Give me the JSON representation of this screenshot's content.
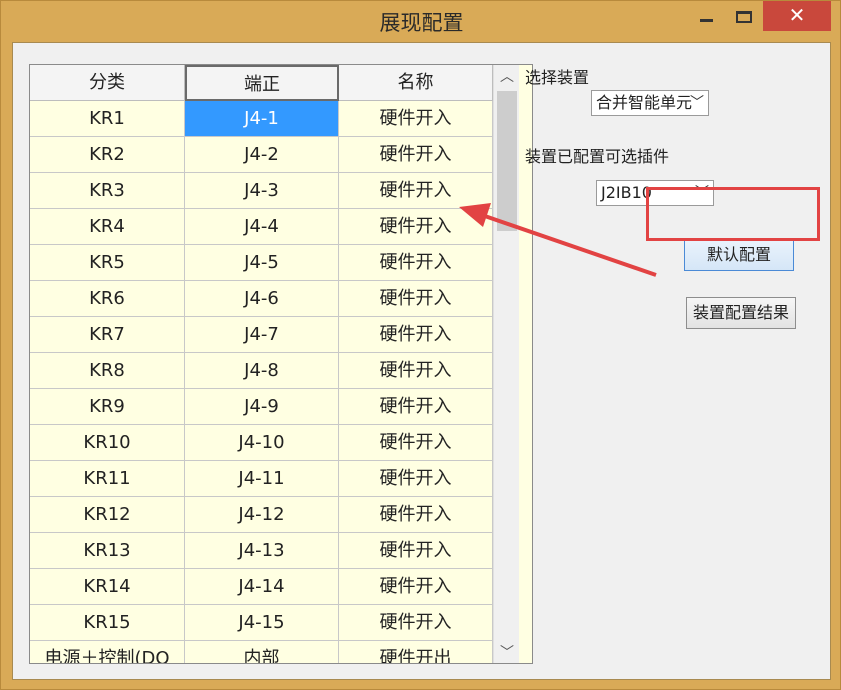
{
  "window": {
    "title": "展现配置",
    "close_glyph": "✕"
  },
  "grid": {
    "headers": [
      "分类",
      "端正",
      "名称"
    ],
    "rows": [
      [
        "KR1",
        "J4-1",
        "硬件开入"
      ],
      [
        "KR2",
        "J4-2",
        "硬件开入"
      ],
      [
        "KR3",
        "J4-3",
        "硬件开入"
      ],
      [
        "KR4",
        "J4-4",
        "硬件开入"
      ],
      [
        "KR5",
        "J4-5",
        "硬件开入"
      ],
      [
        "KR6",
        "J4-6",
        "硬件开入"
      ],
      [
        "KR7",
        "J4-7",
        "硬件开入"
      ],
      [
        "KR8",
        "J4-8",
        "硬件开入"
      ],
      [
        "KR9",
        "J4-9",
        "硬件开入"
      ],
      [
        "KR10",
        "J4-10",
        "硬件开入"
      ],
      [
        "KR11",
        "J4-11",
        "硬件开入"
      ],
      [
        "KR12",
        "J4-12",
        "硬件开入"
      ],
      [
        "KR13",
        "J4-13",
        "硬件开入"
      ],
      [
        "KR14",
        "J4-14",
        "硬件开入"
      ],
      [
        "KR15",
        "J4-15",
        "硬件开入"
      ],
      [
        "电源＋控制(DO",
        "内部",
        "硬件开出"
      ]
    ],
    "selected_row": 0,
    "selected_col": 1
  },
  "panel": {
    "select_device_label": "选择装置",
    "device_value": "合并智能单元",
    "plugin_label": "装置已配置可选插件",
    "plugin_value": "J2IB10",
    "default_config_button": "默认配置",
    "config_result_button": "装置配置结果"
  },
  "colors": {
    "window_frame": "#d9aa57",
    "grid_background": "#ffffe2",
    "selection": "#3399ff",
    "annotation": "#e24343"
  }
}
